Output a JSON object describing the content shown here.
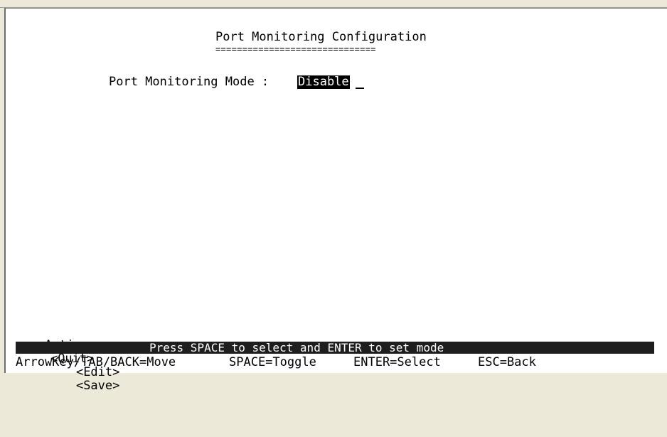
{
  "screen": {
    "title": "Port Monitoring Configuration",
    "title_underline": "=============================="
  },
  "mode": {
    "label": "Port Monitoring Mode :",
    "value": "Disable"
  },
  "actions": {
    "prefix": "Actions->",
    "quit": "<Quit>",
    "edit": "<Edit>",
    "save": "<Save>"
  },
  "hint": "Press SPACE to select and ENTER to set mode",
  "keys": {
    "move": "ArrowKey/TAB/BACK=Move",
    "toggle": "SPACE=Toggle",
    "select": "ENTER=Select",
    "back": "ESC=Back"
  },
  "colors": {
    "terminal_bg": "#ffffff",
    "text": "#000000",
    "highlight_bg": "#000000",
    "hintbar_bg": "#1e1e1e",
    "window_chrome": "#ece9d8"
  }
}
